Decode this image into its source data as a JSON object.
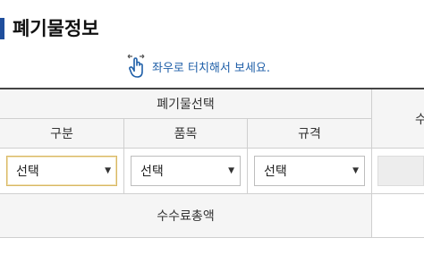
{
  "page": {
    "title": "폐기물정보",
    "accent_color": "#1f4e9c"
  },
  "hint": {
    "icon": "touch-swipe-icon",
    "text": "좌우로 터치해서 보세요."
  },
  "table": {
    "group_header": "폐기물선택",
    "columns": [
      "구분",
      "품목",
      "규격"
    ],
    "selects": [
      {
        "value": "선택"
      },
      {
        "value": "선택"
      },
      {
        "value": "선택"
      }
    ],
    "total_label": "수수료총액",
    "partial_header": "수"
  }
}
